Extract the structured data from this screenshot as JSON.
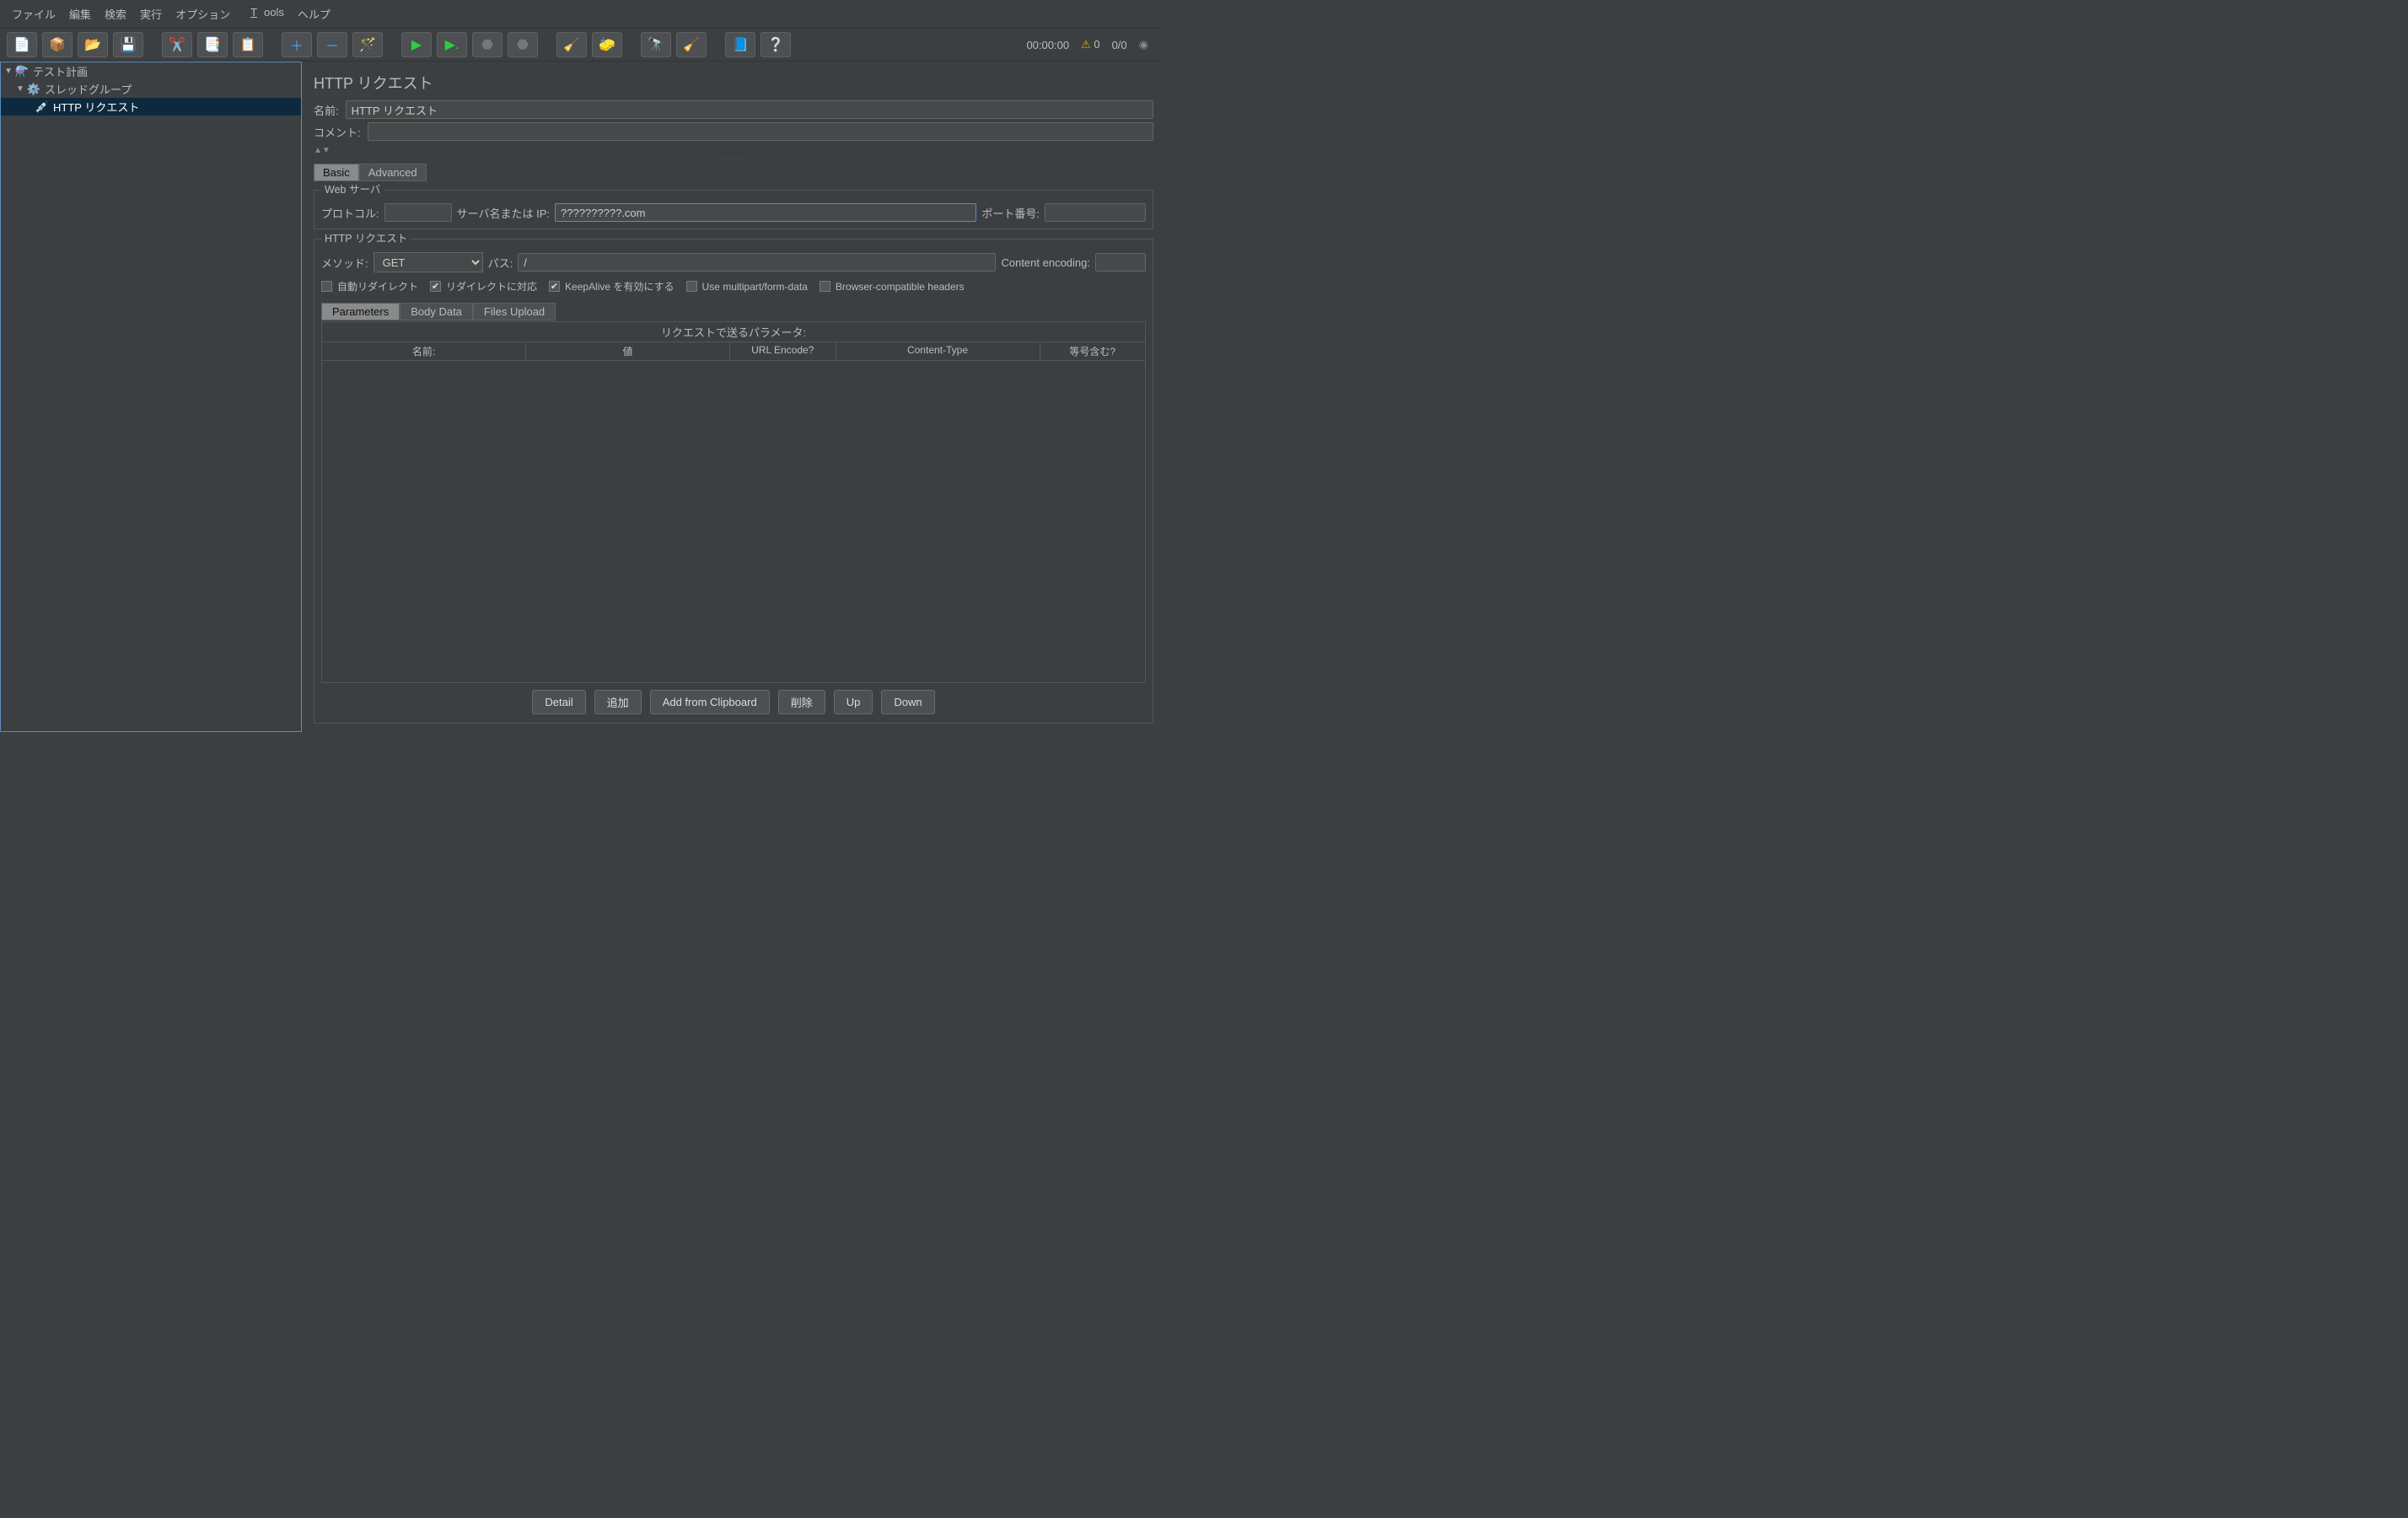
{
  "menubar": [
    "ファイル",
    "編集",
    "検索",
    "実行",
    "オプション",
    "Tools",
    "ヘルプ"
  ],
  "status": {
    "time": "00:00:00",
    "warnCount": "0",
    "threads": "0/0"
  },
  "tree": {
    "root": "テスト計画",
    "group": "スレッドグループ",
    "item": "HTTP リクエスト"
  },
  "panel": {
    "title": "HTTP リクエスト",
    "labels": {
      "name": "名前:",
      "comment": "コメント:",
      "basic": "Basic",
      "advanced": "Advanced",
      "webServer": "Web サーバ",
      "protocol": "プロトコル:",
      "server": "サーバ名または IP:",
      "port": "ポート番号:",
      "httpReq": "HTTP リクエスト",
      "method": "メソッド:",
      "path": "パス:",
      "contentEnc": "Content encoding:"
    },
    "fields": {
      "name": "HTTP リクエスト",
      "comment": "",
      "protocol": "",
      "server": "??????????.com",
      "port": "",
      "method": "GET",
      "path": "/",
      "contentEnc": ""
    },
    "checks": {
      "autoRedirect": "自動リダイレクト",
      "followRedirect": "リダイレクトに対応",
      "keepAlive": "KeepAlive を有効にする",
      "multipart": "Use multipart/form-data",
      "browserHeaders": "Browser-compatible headers"
    },
    "checkState": {
      "autoRedirect": false,
      "followRedirect": true,
      "keepAlive": true,
      "multipart": false,
      "browserHeaders": false
    },
    "paramTabs": [
      "Parameters",
      "Body Data",
      "Files Upload"
    ],
    "paramTitle": "リクエストで送るパラメータ:",
    "paramHeaders": [
      "名前:",
      "値",
      "URL Encode?",
      "Content-Type",
      "等号含む?"
    ],
    "buttons": [
      "Detail",
      "追加",
      "Add from Clipboard",
      "削除",
      "Up",
      "Down"
    ]
  }
}
